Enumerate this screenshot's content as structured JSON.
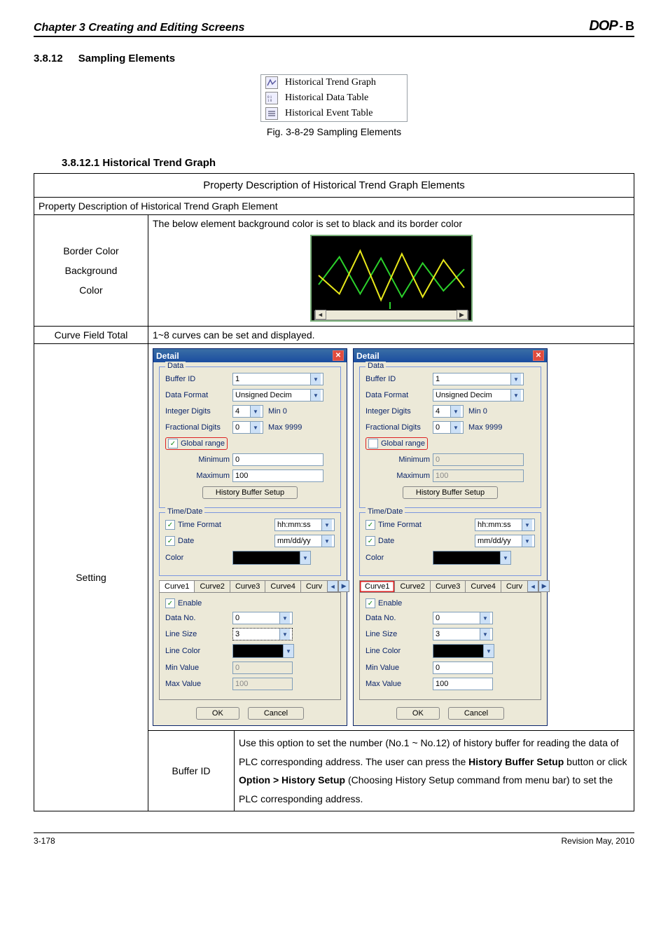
{
  "chapter_title": "Chapter 3 Creating and Editing Screens",
  "logo": {
    "prefix": "DOP",
    "dot": "-",
    "suffix": "B"
  },
  "section": {
    "num": "3.8.12",
    "title": "Sampling Elements"
  },
  "sampling_items": [
    {
      "icon": "trend-icon",
      "label": "Historical Trend Graph"
    },
    {
      "icon": "data-table-icon",
      "label": "Historical Data Table"
    },
    {
      "icon": "event-table-icon",
      "label": "Historical Event Table"
    }
  ],
  "fig_caption": "Fig. 3-8-29 Sampling Elements",
  "subsection": "3.8.12.1 Historical Trend Graph",
  "table": {
    "title": "Property Description of Historical Trend Graph Elements",
    "prop_line": "Property Description of Historical Trend Graph Element",
    "border_bg": {
      "labels": [
        "Border Color",
        "Background",
        "Color"
      ],
      "text": "The below element background color is set to black and its border color"
    },
    "curve_total": {
      "label": "Curve Field Total",
      "text": "1~8 curves can be set and displayed."
    },
    "setting_label": "Setting",
    "buffer_row": {
      "label": "Buffer ID",
      "text": "Use this option to set the number (No.1 ~ No.12) of history buffer for reading the data of PLC corresponding address. The user can press the History Buffer Setup button or click Option > History Setup (Choosing History Setup command from menu bar) to set the PLC corresponding address."
    }
  },
  "dialog": {
    "title": "Detail",
    "data_legend": "Data",
    "buffer_id_label": "Buffer ID",
    "buffer_id_value": "1",
    "data_format_label": "Data Format",
    "data_format_value": "Unsigned Decim",
    "integer_label": "Integer Digits",
    "integer_value": "4",
    "integer_suffix": "Min 0",
    "fractional_label": "Fractional Digits",
    "fractional_value": "0",
    "fractional_suffix": "Max 9999",
    "global_label": "Global range",
    "min_label": "Minimum",
    "min_value": "0",
    "max_label": "Maximum",
    "max_value": "100",
    "history_btn": "History Buffer Setup",
    "time_legend": "Time/Date",
    "time_format_label": "Time Format",
    "time_format_value": "hh:mm:ss",
    "date_label": "Date",
    "date_value": "mm/dd/yy",
    "color_label": "Color",
    "tabs": [
      "Curve1",
      "Curve2",
      "Curve3",
      "Curve4",
      "Curv"
    ],
    "enable_label": "Enable",
    "data_no_label": "Data No.",
    "data_no_value": "0",
    "line_size_label": "Line Size",
    "line_size_value_left": "3",
    "line_size_value_right": "3",
    "line_color_label": "Line Color",
    "minv_label": "Min Value",
    "minv_left": "0",
    "minv_right": "0",
    "maxv_label": "Max Value",
    "maxv_left": "100",
    "maxv_right": "100",
    "ok": "OK",
    "cancel": "Cancel"
  },
  "footer": {
    "page": "3-178",
    "rev": "Revision May, 2010"
  },
  "chart_data": {
    "type": "line",
    "series": [
      {
        "name": "green",
        "values": [
          35,
          80,
          20,
          78,
          15,
          70,
          25,
          60
        ]
      },
      {
        "name": "yellow",
        "values": [
          50,
          20,
          90,
          10,
          85,
          15,
          75,
          30
        ]
      }
    ],
    "x": [
      0,
      1,
      2,
      3,
      4,
      5,
      6,
      7
    ],
    "ylim": [
      0,
      100
    ],
    "title": "",
    "xlabel": "",
    "ylabel": ""
  }
}
